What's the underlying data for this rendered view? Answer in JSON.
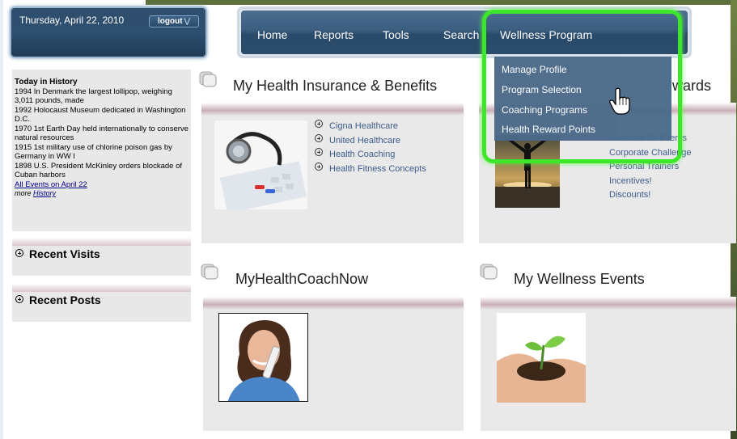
{
  "header": {
    "date": "Thursday, April 22, 2010",
    "logout_label": "logout"
  },
  "nav": {
    "items": [
      "Home",
      "Reports",
      "Tools",
      "Search",
      "Wellness Program"
    ]
  },
  "dropdown": {
    "items": [
      "Manage Profile",
      "Program Selection",
      "Coaching Programs",
      "Health Reward Points"
    ]
  },
  "today_in_history": {
    "title": "Today in History",
    "entries": [
      "1994 In Denmark the largest lollipop, weighing 3,011 pounds, made",
      "1992 Holocaust Museum dedicated in Washington D.C.",
      "1970 1st Earth Day held internationally to conserve natural resources",
      "1915 1st military use of chlorine poison gas by Germany in WW I",
      "1898 U.S. President McKinley orders blockade of Cuban harbors"
    ],
    "all_events_link": "All Events on April 22",
    "more_label": "more",
    "more_link": "History"
  },
  "sidebar": {
    "recent_visits": "Recent Visits",
    "recent_posts": "Recent Posts"
  },
  "panels": {
    "insurance": {
      "title": "My Health Insurance & Benefits",
      "links": [
        "Cigna Healthcare",
        "United Healthcare",
        "Health Coaching",
        "Health Fitness Concepts"
      ]
    },
    "rewards": {
      "title_fragment": "wards",
      "links": [
        "Calendar Of Events",
        "Corporate Challenge",
        "Personal Trainers",
        "Incentives!",
        "Discounts!"
      ]
    },
    "coach": {
      "title": "MyHealthCoachNow"
    },
    "events": {
      "title": "My Wellness Events"
    }
  },
  "colors": {
    "nav_bg": "#3a5d80",
    "highlight_ring": "#3ee62b",
    "link": "#3d5b8b",
    "panel_bg": "#e9e9e9"
  }
}
